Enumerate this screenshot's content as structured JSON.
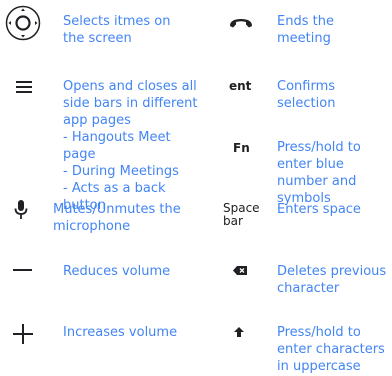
{
  "left": [
    {
      "icon": "dpad-select-icon",
      "text": "Selects itmes on the screen"
    },
    {
      "icon": "hamburger-menu-icon",
      "text": "Opens and closes all side bars in different app pages\n- Hangouts Meet page\n- During Meetings\n- Acts as a back button"
    },
    {
      "icon": "microphone-icon",
      "text": "Mutes/Unmutes the microphone"
    },
    {
      "icon": "minus-icon",
      "text": "Reduces volume"
    },
    {
      "icon": "plus-icon",
      "text": "Increases volume"
    }
  ],
  "right": [
    {
      "icon": "hang-up-icon",
      "text": "Ends the meeting"
    },
    {
      "key": "ent",
      "text": "Confirms selection"
    },
    {
      "key": "Fn",
      "text": "Press/hold to enter blue number and symbols"
    },
    {
      "key": "Space\nbar",
      "text": "Enters space"
    },
    {
      "icon": "backspace-icon",
      "text": "Deletes previous character"
    },
    {
      "icon": "shift-arrow-icon",
      "text": "Press/hold to enter characters in uppercase"
    }
  ],
  "colors": {
    "accent": "#4285f4",
    "icon": "#202124"
  }
}
